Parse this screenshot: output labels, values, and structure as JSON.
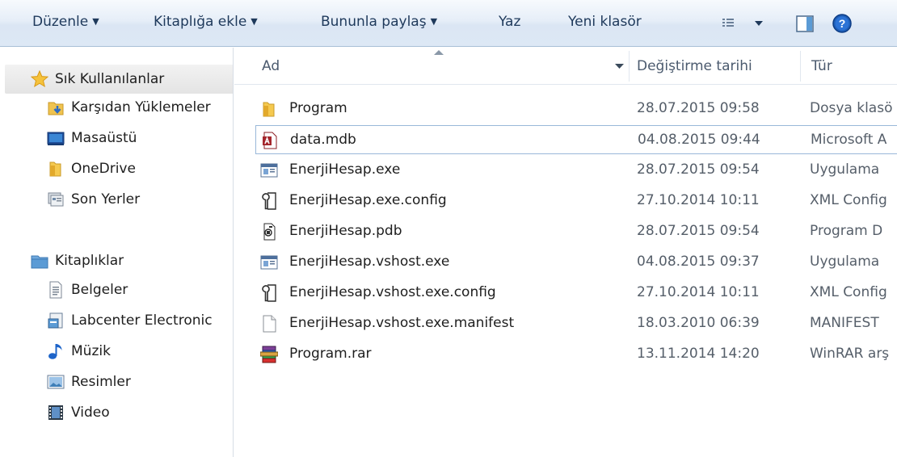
{
  "toolbar": {
    "organize": "Düzenle",
    "include_library": "Kitaplığa ekle",
    "share_with": "Bununla paylaş",
    "burn": "Yaz",
    "new_folder": "Yeni klasör",
    "icons": [
      "view-options-icon",
      "preview-pane-icon",
      "help-icon"
    ]
  },
  "nav": {
    "favorites": {
      "label": "Sık Kullanılanlar",
      "items": [
        {
          "label": "Karşıdan Yüklemeler",
          "icon": "downloads-icon"
        },
        {
          "label": "Masaüstü",
          "icon": "desktop-icon"
        },
        {
          "label": "OneDrive",
          "icon": "folder-icon"
        },
        {
          "label": "Son Yerler",
          "icon": "recent-places-icon"
        }
      ]
    },
    "libraries": {
      "label": "Kitaplıklar",
      "items": [
        {
          "label": "Belgeler",
          "icon": "documents-icon"
        },
        {
          "label": "Labcenter Electronic",
          "icon": "library-icon"
        },
        {
          "label": "Müzik",
          "icon": "music-icon"
        },
        {
          "label": "Resimler",
          "icon": "pictures-icon"
        },
        {
          "label": "Video",
          "icon": "video-icon"
        }
      ]
    }
  },
  "columns": {
    "name": "Ad",
    "date": "Değiştirme tarihi",
    "type": "Tür"
  },
  "files": [
    {
      "name": "Program",
      "date": "28.07.2015 09:58",
      "type": "Dosya klasö",
      "icon": "folder-icon"
    },
    {
      "name": "data.mdb",
      "date": "04.08.2015 09:44",
      "type": "Microsoft A",
      "icon": "access-db-icon",
      "selected": true
    },
    {
      "name": "EnerjiHesap.exe",
      "date": "28.07.2015 09:54",
      "type": "Uygulama",
      "icon": "application-icon"
    },
    {
      "name": "EnerjiHesap.exe.config",
      "date": "27.10.2014 10:11",
      "type": "XML Config",
      "icon": "config-icon"
    },
    {
      "name": "EnerjiHesap.pdb",
      "date": "28.07.2015 09:54",
      "type": "Program D",
      "icon": "pdb-icon"
    },
    {
      "name": "EnerjiHesap.vshost.exe",
      "date": "04.08.2015 09:37",
      "type": "Uygulama",
      "icon": "application-icon"
    },
    {
      "name": "EnerjiHesap.vshost.exe.config",
      "date": "27.10.2014 10:11",
      "type": "XML Config",
      "icon": "config-icon"
    },
    {
      "name": "EnerjiHesap.vshost.exe.manifest",
      "date": "18.03.2010 06:39",
      "type": "MANIFEST",
      "icon": "file-icon"
    },
    {
      "name": "Program.rar",
      "date": "13.11.2014 14:20",
      "type": "WinRAR arş",
      "icon": "winrar-icon"
    }
  ]
}
